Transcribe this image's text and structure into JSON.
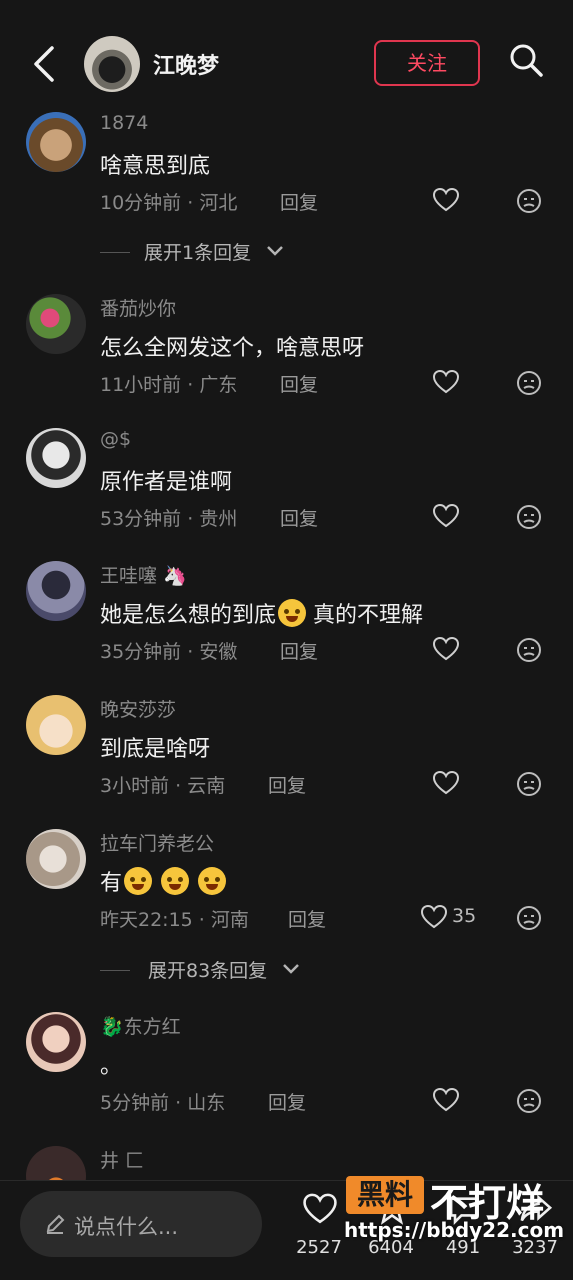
{
  "header": {
    "author_name": "江晚梦",
    "follow_label": "关注"
  },
  "comments": [
    {
      "user": "1874",
      "text": "啥意思到底",
      "time": "10分钟前",
      "location": "河北",
      "reply": "回复",
      "likes": ""
    },
    {
      "user": "番茄炒你",
      "text": "怎么全网发这个，啥意思呀",
      "time": "11小时前",
      "location": "广东",
      "reply": "回复",
      "likes": ""
    },
    {
      "user": "@$",
      "text": "原作者是谁啊",
      "time": "53分钟前",
      "location": "贵州",
      "reply": "回复",
      "likes": ""
    },
    {
      "user": "王哇噻",
      "text_a": "她是怎么想的到底",
      "text_b": "真的不理解",
      "time": "35分钟前",
      "location": "安徽",
      "reply": "回复",
      "likes": ""
    },
    {
      "user": "晚安莎莎",
      "text": "到底是啥呀",
      "time": "3小时前",
      "location": "云南",
      "reply": "回复",
      "likes": ""
    },
    {
      "user": "拉车门养老公",
      "text": "有",
      "time": "昨天22:15",
      "location": "河南",
      "reply": "回复",
      "likes": "35"
    },
    {
      "user": "东方红",
      "text": "。",
      "time": "5分钟前",
      "location": "山东",
      "reply": "回复",
      "likes": ""
    },
    {
      "user": "井 匚",
      "text": ""
    }
  ],
  "expanders": [
    {
      "label": "展开1条回复"
    },
    {
      "label": "展开83条回复"
    }
  ],
  "bottom_bar": {
    "input_placeholder": "说点什么...",
    "likes_count": "2527",
    "stars_count": "6404",
    "comments_count": "491",
    "shares_count": "3237"
  },
  "watermark": {
    "box_text": "黑料",
    "big_text": "不打烊",
    "url": "https://bbdy22.com"
  },
  "colors": {
    "background": "#161616",
    "accent": "#e0364f",
    "watermark_orange": "#f08a2a"
  },
  "icons": [
    "back-arrow-icon",
    "search-icon",
    "heart-icon",
    "dislike-face-icon",
    "chevron-down-icon",
    "pencil-icon",
    "star-icon",
    "comment-icon",
    "share-icon"
  ]
}
